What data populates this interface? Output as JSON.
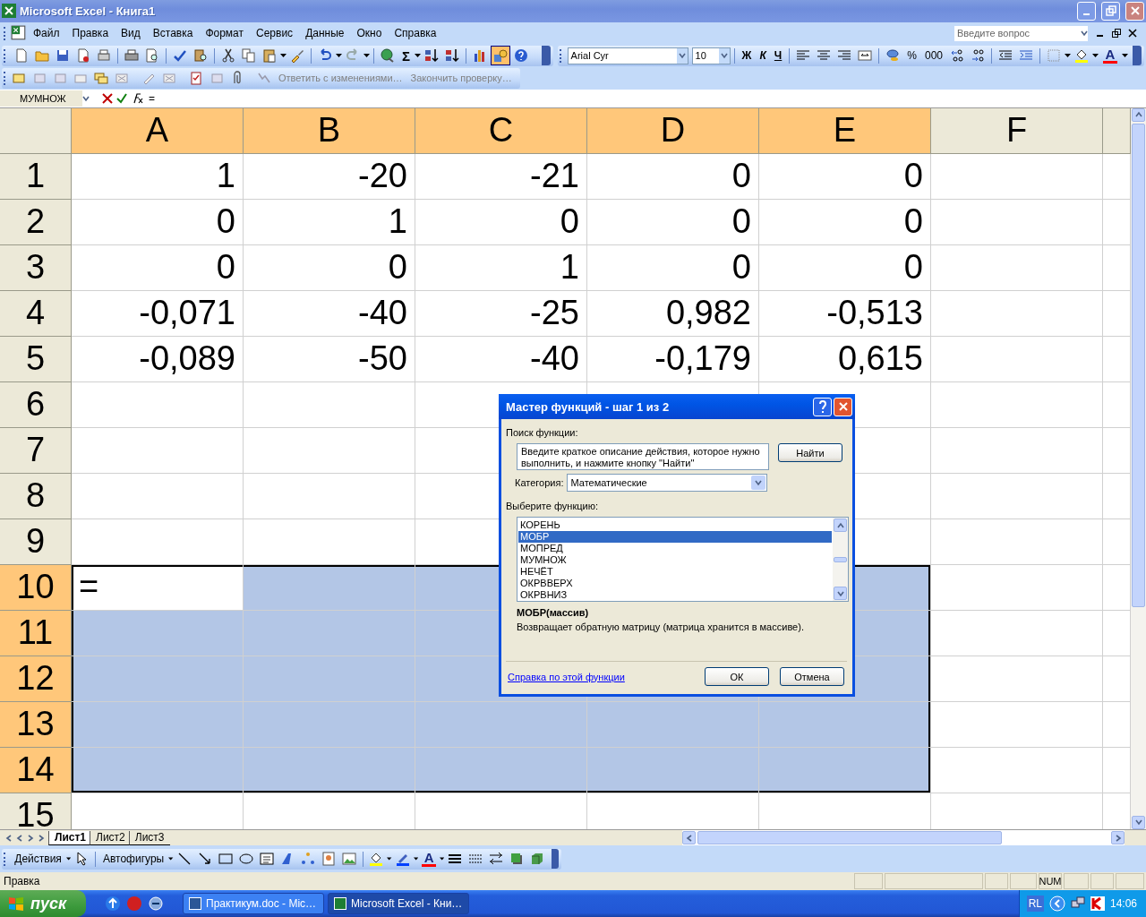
{
  "window": {
    "title": "Microsoft Excel - Книга1"
  },
  "menu": [
    "Файл",
    "Правка",
    "Вид",
    "Вставка",
    "Формат",
    "Сервис",
    "Данные",
    "Окно",
    "Справка"
  ],
  "question_box": {
    "placeholder": "Введите вопрос"
  },
  "standard_toolbar": {
    "sum_label": "Σ",
    "drawing_on": true
  },
  "formatting_toolbar": {
    "font": "Arial Cyr",
    "size": "10",
    "bold": "Ж",
    "italic": "К",
    "underline": "Ч",
    "percent": "%",
    "thousands": "000",
    "font_color": "A"
  },
  "review_toolbar": {
    "reply": "Ответить с изменениями…",
    "end_review": "Закончить проверку…"
  },
  "formula_bar": {
    "name_box": "МУМНОЖ",
    "formula": "="
  },
  "sheet": {
    "columns": [
      {
        "label": "A",
        "selected": true
      },
      {
        "label": "B",
        "selected": true
      },
      {
        "label": "C",
        "selected": true
      },
      {
        "label": "D",
        "selected": true
      },
      {
        "label": "E",
        "selected": true
      },
      {
        "label": "F",
        "selected": false
      }
    ],
    "rows": [
      {
        "label": "1",
        "selected": false,
        "cells": [
          "1",
          "-20",
          "-21",
          "0",
          "0"
        ]
      },
      {
        "label": "2",
        "selected": false,
        "cells": [
          "0",
          "1",
          "0",
          "0",
          "0"
        ]
      },
      {
        "label": "3",
        "selected": false,
        "cells": [
          "0",
          "0",
          "1",
          "0",
          "0"
        ]
      },
      {
        "label": "4",
        "selected": false,
        "cells": [
          "-0,071",
          "-40",
          "-25",
          "0,982",
          "-0,513"
        ]
      },
      {
        "label": "5",
        "selected": false,
        "cells": [
          "-0,089",
          "-50",
          "-40",
          "-0,179",
          "0,615"
        ]
      },
      {
        "label": "6",
        "selected": false
      },
      {
        "label": "7",
        "selected": false
      },
      {
        "label": "8",
        "selected": false
      },
      {
        "label": "9",
        "selected": false
      },
      {
        "label": "10",
        "selected": true,
        "cells": [
          "="
        ]
      },
      {
        "label": "11",
        "selected": true
      },
      {
        "label": "12",
        "selected": true
      },
      {
        "label": "13",
        "selected": true
      },
      {
        "label": "14",
        "selected": true
      },
      {
        "label": "15",
        "selected": false
      }
    ]
  },
  "sheet_tabs": [
    {
      "label": "Лист1",
      "selected": true
    },
    {
      "label": "Лист2",
      "selected": false
    },
    {
      "label": "Лист3",
      "selected": false
    }
  ],
  "drawing_toolbar": {
    "actions": "Действия",
    "autoshapes": "Автофигуры",
    "font_color": "A"
  },
  "status_bar": {
    "mode": "Правка",
    "indicator": "NUM"
  },
  "taskbar": {
    "start": "пуск",
    "tasks": [
      {
        "label": "Практикум.doc - Mic…",
        "selected": false
      },
      {
        "label": "Microsoft Excel - Кни…",
        "selected": true
      }
    ],
    "language": "RL",
    "clock": "14:06"
  },
  "dialog": {
    "title": "Мастер функций - шаг 1 из 2",
    "search_label": "Поиск функции:",
    "search_text": "Введите краткое описание действия, которое нужно выполнить, и нажмите кнопку \"Найти\"",
    "find_button": "Найти",
    "category_label": "Категория:",
    "category": "Математические",
    "list_label": "Выберите функцию:",
    "functions": [
      {
        "name": "КОРЕНЬ",
        "selected": false
      },
      {
        "name": "МОБР",
        "selected": true
      },
      {
        "name": "МОПРЕД",
        "selected": false
      },
      {
        "name": "МУМНОЖ",
        "selected": false
      },
      {
        "name": "НЕЧЁТ",
        "selected": false
      },
      {
        "name": "ОКРВВЕРХ",
        "selected": false
      },
      {
        "name": "ОКРВНИЗ",
        "selected": false
      }
    ],
    "signature": "МОБР(массив)",
    "description": "Возвращает обратную матрицу (матрица хранится в массиве).",
    "help_link": "Справка по этой функции",
    "ok": "ОК",
    "cancel": "Отмена"
  }
}
